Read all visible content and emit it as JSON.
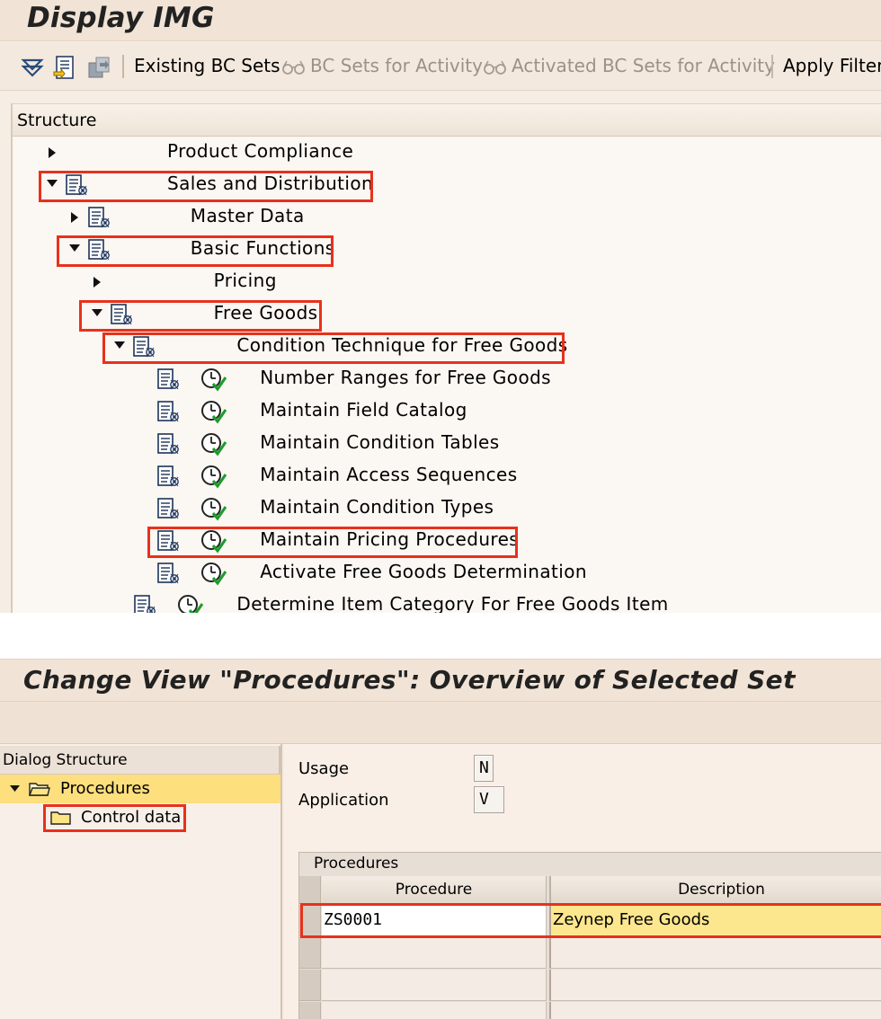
{
  "top_window": {
    "title": "Display IMG",
    "toolbar": {
      "existing_bc_sets": "Existing BC Sets",
      "bc_sets_for_activity": "BC Sets for Activity",
      "activated_bc_sets": "Activated BC Sets for Activity",
      "apply_filter": "Apply Filter"
    },
    "structure_header": "Structure",
    "tree": [
      {
        "label": "Product Compliance",
        "state": "collapsed",
        "icon": "none",
        "highlighted": false
      },
      {
        "label": "Sales and Distribution",
        "state": "expanded",
        "icon": "doc-icon",
        "highlighted": true
      },
      {
        "label": "Master Data",
        "state": "collapsed",
        "icon": "doc-icon",
        "highlighted": false
      },
      {
        "label": "Basic Functions",
        "state": "expanded",
        "icon": "doc-icon",
        "highlighted": true
      },
      {
        "label": "Pricing",
        "state": "collapsed",
        "icon": "none",
        "highlighted": false
      },
      {
        "label": "Free Goods",
        "state": "expanded",
        "icon": "doc-icon",
        "highlighted": true
      },
      {
        "label": "Condition Technique for Free Goods",
        "state": "expanded",
        "icon": "doc-icon",
        "highlighted": true
      },
      {
        "label": "Number Ranges for Free Goods",
        "state": "leaf",
        "icon": "doc-clock-icon",
        "highlighted": false
      },
      {
        "label": "Maintain Field Catalog",
        "state": "leaf",
        "icon": "doc-clock-icon",
        "highlighted": false
      },
      {
        "label": "Maintain Condition Tables",
        "state": "leaf",
        "icon": "doc-clock-icon",
        "highlighted": false
      },
      {
        "label": "Maintain Access Sequences",
        "state": "leaf",
        "icon": "doc-clock-icon",
        "highlighted": false
      },
      {
        "label": "Maintain Condition Types",
        "state": "leaf",
        "icon": "doc-clock-icon",
        "highlighted": false
      },
      {
        "label": "Maintain Pricing Procedures",
        "state": "leaf",
        "icon": "doc-clock-icon",
        "highlighted": true
      },
      {
        "label": "Activate Free Goods Determination",
        "state": "leaf",
        "icon": "doc-clock-icon",
        "highlighted": false
      },
      {
        "label": "Determine Item Category For Free Goods Item",
        "state": "leaf",
        "icon": "doc-clock-icon",
        "highlighted": false
      }
    ]
  },
  "bottom_window": {
    "title": "Change View \"Procedures\": Overview of Selected Set",
    "dialog_structure": {
      "header": "Dialog Structure",
      "items": [
        {
          "label": "Procedures",
          "selected": true,
          "open": true
        },
        {
          "label": "Control data",
          "selected": false,
          "open": false
        }
      ]
    },
    "fields": {
      "usage_label": "Usage",
      "usage_value": "N",
      "application_label": "Application",
      "application_value": "V"
    },
    "table": {
      "title": "Procedures",
      "columns": [
        "Procedure",
        "Description"
      ],
      "rows": [
        {
          "procedure": "ZS0001",
          "description": "Zeynep Free Goods"
        }
      ]
    }
  },
  "colors": {
    "highlight_box": "#e8311b",
    "selected_row": "#fde58a",
    "selected_tree_item": "#fddf7d"
  }
}
